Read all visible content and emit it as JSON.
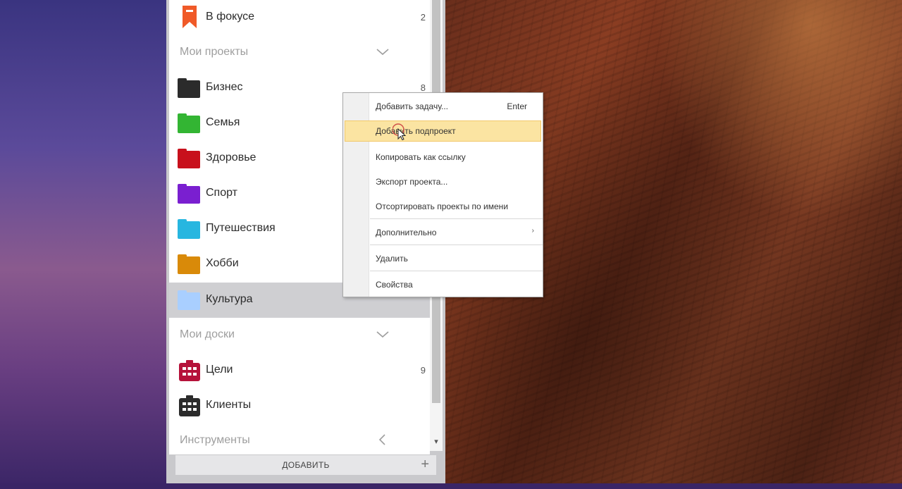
{
  "sidebar": {
    "focus": {
      "label": "В фокусе",
      "count": "2",
      "icon": "bookmark-icon",
      "color": "#f05a28"
    },
    "projects_section": {
      "label": "Мои проекты"
    },
    "projects": [
      {
        "label": "Бизнес",
        "count": "8",
        "color": "#2b2b2b"
      },
      {
        "label": "Семья",
        "count": "",
        "color": "#33b533"
      },
      {
        "label": "Здоровье",
        "count": "",
        "color": "#c8101c"
      },
      {
        "label": "Спорт",
        "count": "",
        "color": "#7a1fd0"
      },
      {
        "label": "Путешествия",
        "count": "",
        "color": "#27b6e0"
      },
      {
        "label": "Хобби",
        "count": "",
        "color": "#d98a09"
      },
      {
        "label": "Культура",
        "count": "",
        "color": "#a9cfff"
      }
    ],
    "boards_section": {
      "label": "Мои доски"
    },
    "boards": [
      {
        "label": "Цели",
        "count": "9",
        "color": "#b5123a"
      },
      {
        "label": "Клиенты",
        "count": "",
        "color": "#2b2b2b"
      }
    ],
    "tools_section": {
      "label": "Инструменты"
    },
    "add_button": {
      "label": "ДОБАВИТЬ",
      "plus": "+"
    }
  },
  "context_menu": {
    "items": [
      {
        "label": "Добавить задачу...",
        "shortcut": "Enter"
      },
      {
        "label": "Добавить подпроект",
        "shortcut": ""
      },
      {
        "label": "Копировать как ссылку",
        "shortcut": ""
      },
      {
        "label": "Экспорт проекта...",
        "shortcut": ""
      },
      {
        "label": "Отсортировать проекты по имени",
        "shortcut": ""
      },
      {
        "label": "Дополнительно",
        "shortcut": "",
        "arrow": "›"
      },
      {
        "label": "Удалить",
        "shortcut": ""
      },
      {
        "label": "Свойства",
        "shortcut": ""
      }
    ]
  },
  "colors": {
    "menu_highlight": "#fbe4a2",
    "selected_row": "#cfcfd2"
  }
}
